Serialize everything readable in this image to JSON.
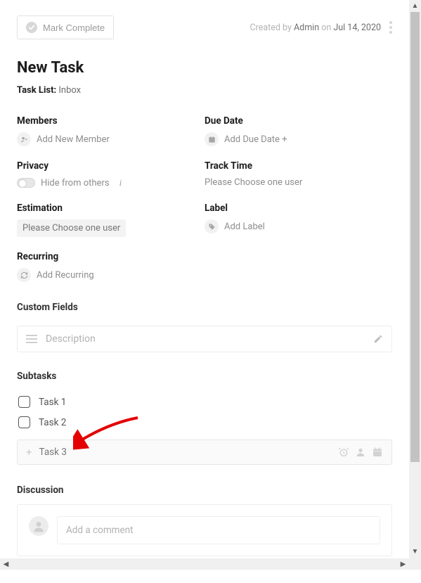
{
  "header": {
    "mark_complete": "Mark Complete",
    "created_prefix": "Created by ",
    "created_user": "Admin",
    "created_on_word": " on ",
    "created_date": "Jul 14, 2020"
  },
  "task": {
    "title": "New Task",
    "tasklist_label": "Task List:",
    "tasklist_value": " Inbox"
  },
  "fields": {
    "members": {
      "label": "Members",
      "action": "Add New Member"
    },
    "due_date": {
      "label": "Due Date",
      "action": "Add Due Date +"
    },
    "privacy": {
      "label": "Privacy",
      "option": "Hide from others"
    },
    "track_time": {
      "label": "Track Time",
      "placeholder": "Please Choose one user"
    },
    "estimation": {
      "label": "Estimation",
      "placeholder": "Please Choose one user"
    },
    "label_field": {
      "label": "Label",
      "action": "Add Label"
    },
    "recurring": {
      "label": "Recurring",
      "action": "Add Recurring"
    }
  },
  "custom_fields": {
    "heading": "Custom Fields",
    "description_placeholder": "Description"
  },
  "subtasks": {
    "heading": "Subtasks",
    "items": [
      {
        "label": "Task 1"
      },
      {
        "label": "Task 2"
      }
    ],
    "add_placeholder": "Task 3"
  },
  "discussion": {
    "heading": "Discussion",
    "comment_placeholder": "Add a comment"
  }
}
